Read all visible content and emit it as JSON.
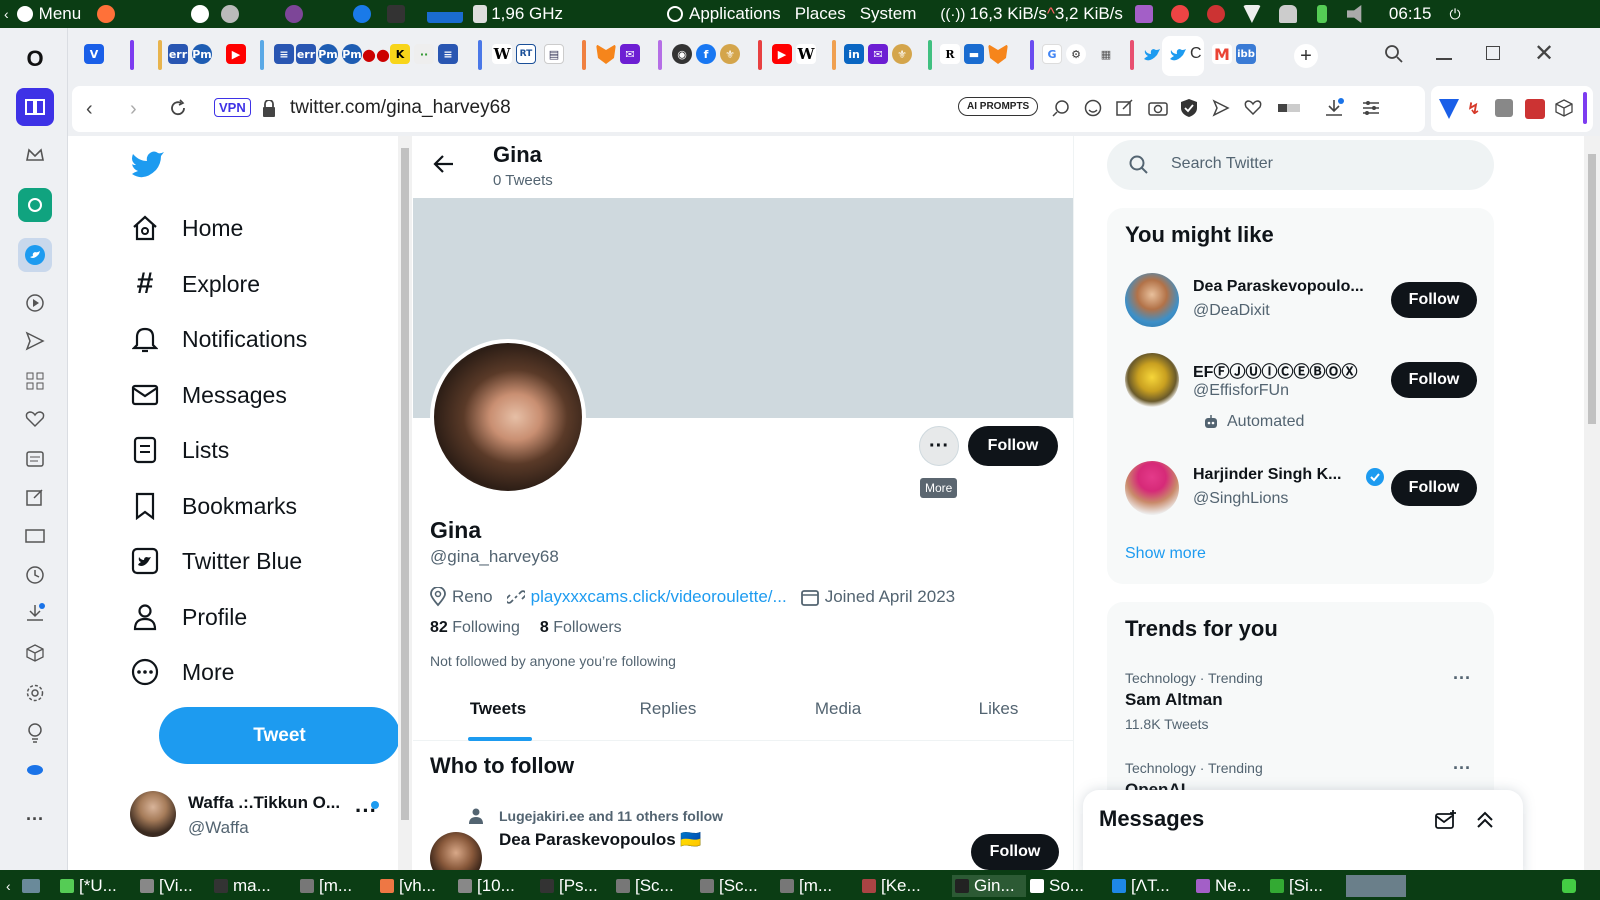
{
  "system_panel": {
    "menu_label": "Menu",
    "cpu_freq": "1,96 GHz",
    "applications": "Applications",
    "places": "Places",
    "system": "System",
    "net_down": "16,3 KiB/s",
    "net_up": "3,2 KiB/s",
    "clock": "06:15"
  },
  "tab_favicons": [
    "W",
    "RT",
    "K",
    "in",
    "M",
    "R",
    "G"
  ],
  "address": {
    "vpn_label": "VPN",
    "url": "twitter.com/gina_harvey68",
    "ai_prompts_label": "AI PROMPTS"
  },
  "nav": {
    "home": "Home",
    "explore": "Explore",
    "notifications": "Notifications",
    "messages": "Messages",
    "lists": "Lists",
    "bookmarks": "Bookmarks",
    "twitter_blue": "Twitter Blue",
    "profile": "Profile",
    "more": "More",
    "tweet_button": "Tweet",
    "account_name": "Waffa .:.Tikkun O...",
    "account_handle": "@Waffa"
  },
  "profile": {
    "header_name": "Gina",
    "tweet_count": "0 Tweets",
    "name": "Gina",
    "handle": "@gina_harvey68",
    "location": "Reno",
    "link": "playxxxcams.click/videoroulette/...",
    "joined": "Joined April 2023",
    "following_count": "82",
    "following_label": "Following",
    "followers_count": "8",
    "followers_label": "Followers",
    "not_followed_note": "Not followed by anyone you’re following",
    "follow_button": "Follow",
    "more_tooltip": "More"
  },
  "profile_tabs": [
    "Tweets",
    "Replies",
    "Media",
    "Likes"
  ],
  "who_to_follow": {
    "title": "Who to follow",
    "social_context": "Lugejakiri.ee and 11 others follow",
    "name": "Dea Paraskevopoulos 🇺🇦",
    "follow_button": "Follow"
  },
  "search": {
    "placeholder": "Search Twitter"
  },
  "you_might_like": {
    "title": "You might like",
    "users": [
      {
        "name": "Dea Paraskevopoulo...",
        "handle": "@DeaDixit",
        "follow": "Follow",
        "badge": ""
      },
      {
        "name": "EFⒻⒿⓊⒾⒸⒺⒷⓄⓍ",
        "handle": "@EffisforFUn",
        "follow": "Follow",
        "badge": "Automated"
      },
      {
        "name": "Harjinder Singh K...",
        "handle": "@SinghLions",
        "follow": "Follow",
        "badge": ""
      }
    ],
    "show_more": "Show more"
  },
  "trends": {
    "title": "Trends for you",
    "items": [
      {
        "context": "Technology · Trending",
        "name": "Sam Altman",
        "count": "11.8K Tweets"
      },
      {
        "context": "Technology · Trending",
        "name": "OpenAI",
        "count": ""
      }
    ]
  },
  "messages_drawer": {
    "title": "Messages"
  },
  "taskbar": {
    "items": [
      "[*U...",
      "[Vi...",
      "ma...",
      "[m...",
      "[vh...",
      "[10...",
      "[Ps...",
      "[Sc...",
      "[Sc...",
      "[m...",
      "[Ke...",
      "Gin...",
      "So...",
      "[ΛT...",
      "Ne...",
      "[Si..."
    ]
  },
  "colors": {
    "twitter_blue": "#1d9bf0",
    "panel_green": "#0b3d14",
    "text_primary": "#0f1419",
    "text_secondary": "#536471",
    "banner_gray": "#cfd9de",
    "opera_accent": "#3e32e6"
  }
}
